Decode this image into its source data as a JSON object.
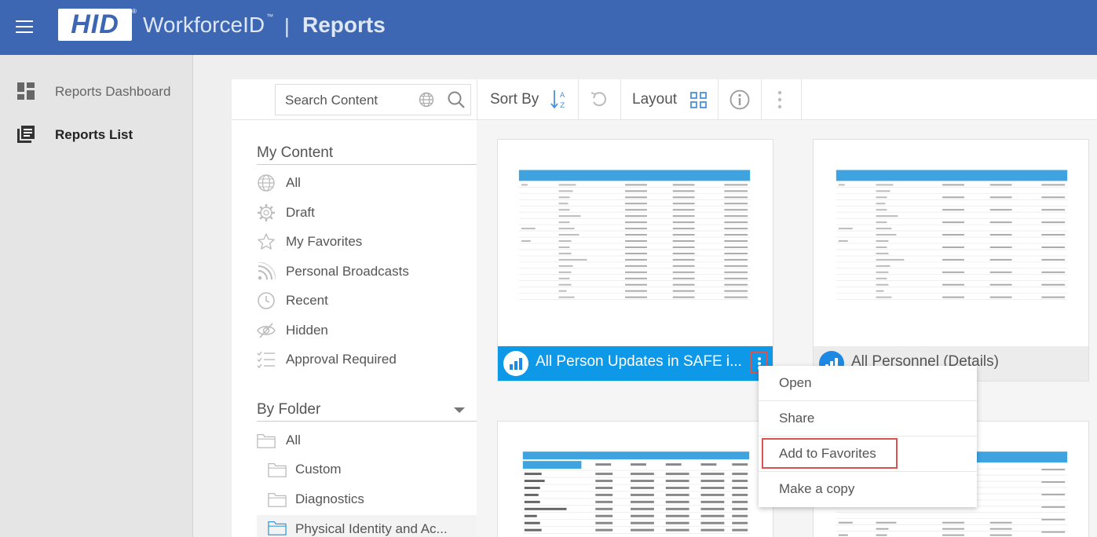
{
  "header": {
    "logo": "HID",
    "logo_reg": "®",
    "app_name": "WorkforceID",
    "app_tm": "™",
    "separator": "|",
    "section": "Reports"
  },
  "sidebar": {
    "items": [
      {
        "label": "Reports Dashboard",
        "icon": "dashboard-icon",
        "active": false
      },
      {
        "label": "Reports List",
        "icon": "reports-list-icon",
        "active": true
      }
    ]
  },
  "toolbar": {
    "search_placeholder": "Search Content",
    "sort_label": "Sort By",
    "layout_label": "Layout"
  },
  "my_content": {
    "title": "My Content",
    "items": [
      {
        "label": "All",
        "icon": "globe-icon"
      },
      {
        "label": "Draft",
        "icon": "gear-icon"
      },
      {
        "label": "My Favorites",
        "icon": "star-icon"
      },
      {
        "label": "Personal Broadcasts",
        "icon": "rss-icon"
      },
      {
        "label": "Recent",
        "icon": "clock-icon"
      },
      {
        "label": "Hidden",
        "icon": "eye-off-icon"
      },
      {
        "label": "Approval Required",
        "icon": "checklist-icon"
      }
    ]
  },
  "by_folder": {
    "title": "By Folder",
    "items": [
      {
        "label": "All",
        "level": 0
      },
      {
        "label": "Custom",
        "level": 1
      },
      {
        "label": "Diagnostics",
        "level": 1
      },
      {
        "label": "Physical Identity and Ac...",
        "level": 1,
        "selected": true
      }
    ]
  },
  "cards": [
    {
      "title": "All Person Updates in SAFE i...",
      "state": "selected"
    },
    {
      "title": "All Personnel (Details)",
      "state": "normal"
    }
  ],
  "context_menu": {
    "items": [
      "Open",
      "Share",
      "Add to Favorites",
      "Make a copy"
    ],
    "highlighted": "Add to Favorites"
  },
  "colors": {
    "header": "#3d67b3",
    "card_selected": "#0d98e8",
    "highlight": "#d9534f",
    "accent_icon": "#1e88e5"
  }
}
